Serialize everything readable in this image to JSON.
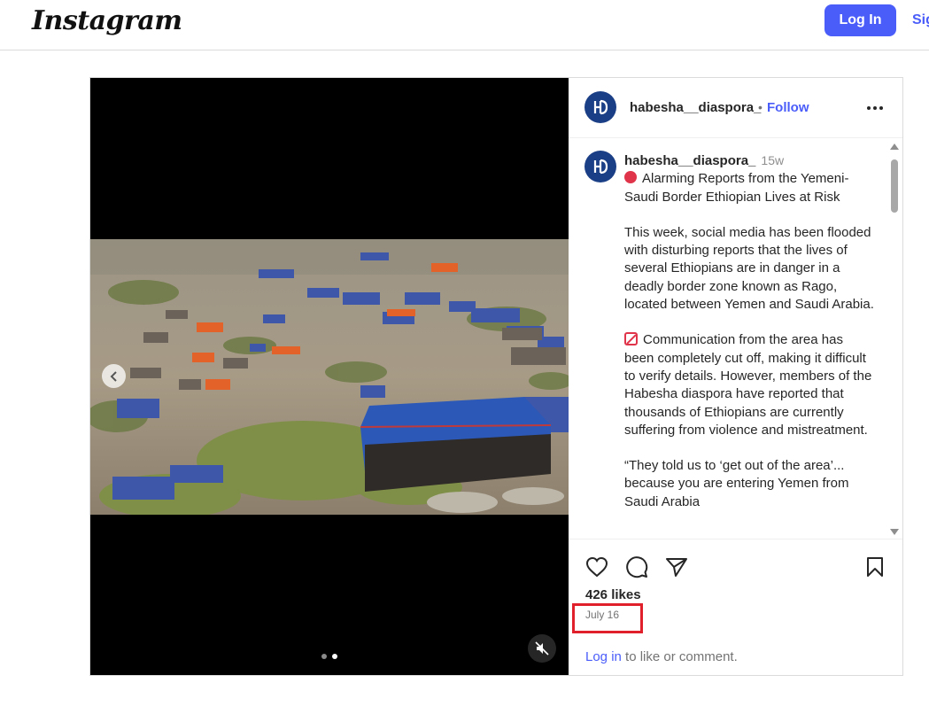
{
  "topbar": {
    "logo": "Instagram",
    "login_label": "Log In",
    "signup_label": "Sig"
  },
  "post": {
    "author": "habesha__diaspora_",
    "separator": "•",
    "follow_label": "Follow",
    "caption": {
      "username": "habesha__diaspora_",
      "time": "15w",
      "title": "Alarming Reports from the Yemeni-Saudi Border Ethiopian Lives at Risk",
      "para1": "This week, social media has been flooded with disturbing reports that the lives of several Ethiopians are in danger in a deadly border zone known as Rago, located between Yemen and Saudi Arabia.",
      "para2": "Communication from the area has been completely cut off, making it difficult to verify details. However, members of the Habesha diaspora have reported that thousands of Ethiopians are currently suffering from violence and mistreatment.",
      "para3": "“They told us to ‘get out of the area’... because you are entering Yemen from Saudi Arabia"
    },
    "likes": "426 likes",
    "date": "July 16",
    "login_link": "Log in",
    "login_suffix": " to like or comment.",
    "carousel": {
      "total": 2,
      "active_index": 1
    }
  },
  "icons": [
    "heart-icon",
    "comment-icon",
    "share-icon",
    "bookmark-icon",
    "more-icon",
    "mute-icon",
    "chevron-left-icon"
  ],
  "colors": {
    "accent": "#4a5df9",
    "avatar": "#1b3f86",
    "highlight": "#e0202a"
  }
}
